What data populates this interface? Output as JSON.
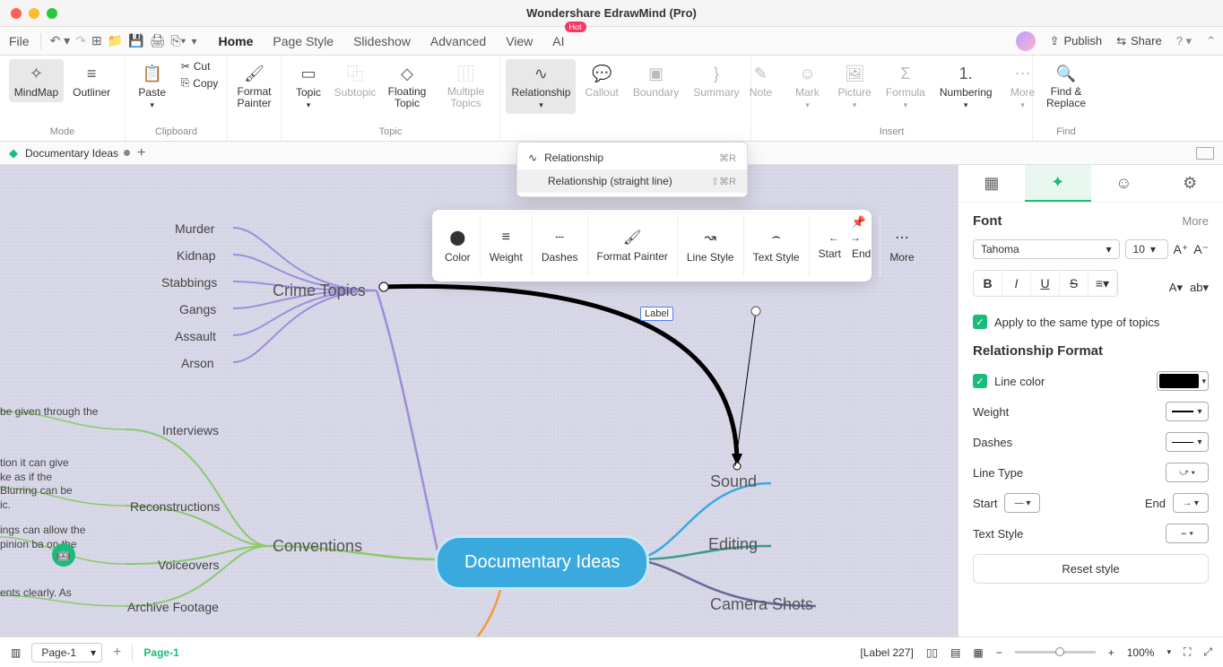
{
  "titlebar": {
    "title": "Wondershare EdrawMind (Pro)"
  },
  "menubar": {
    "file": "File",
    "tabs": [
      "Home",
      "Page Style",
      "Slideshow",
      "Advanced",
      "View",
      "AI"
    ],
    "active": "Home",
    "hot": "Hot",
    "publish": "Publish",
    "share": "Share"
  },
  "ribbon": {
    "mindmap": "MindMap",
    "outliner": "Outliner",
    "mode": "Mode",
    "paste": "Paste",
    "cut": "Cut",
    "copy": "Copy",
    "clipboard": "Clipboard",
    "format_painter": "Format Painter",
    "topic": "Topic",
    "subtopic": "Subtopic",
    "floating_topic": "Floating Topic",
    "multiple_topics": "Multiple Topics",
    "topic_group": "Topic",
    "relationship": "Relationship",
    "callout": "Callout",
    "boundary": "Boundary",
    "summary": "Summary",
    "note": "Note",
    "mark": "Mark",
    "picture": "Picture",
    "formula": "Formula",
    "numbering": "Numbering",
    "more": "More",
    "insert": "Insert",
    "find_replace": "Find & Replace",
    "find": "Find"
  },
  "rel_menu": {
    "item1": "Relationship",
    "item1_sc": "⌘R",
    "item2": "Relationship (straight line)",
    "item2_sc": "⇧⌘R"
  },
  "doc_tab": {
    "name": "Documentary Ideas"
  },
  "context": {
    "color": "Color",
    "weight": "Weight",
    "dashes": "Dashes",
    "format_painter": "Format Painter",
    "line_style": "Line Style",
    "text_style": "Text Style",
    "start": "Start",
    "end": "End",
    "more": "More"
  },
  "mindmap": {
    "central": "Documentary Ideas",
    "crime": "Crime Topics",
    "crime_children": [
      "Murder",
      "Kidnap",
      "Stabbings",
      "Gangs",
      "Assault",
      "Arson"
    ],
    "conventions": "Conventions",
    "conv_children": [
      "Interviews",
      "Reconstructions",
      "Voiceovers",
      "Archive Footage"
    ],
    "right_children": [
      "Sound",
      "Editing",
      "Camera Shots"
    ],
    "left_fragments_a": "be given through the",
    "left_fragments_b1": "tion it can give",
    "left_fragments_b2": "ke as if the",
    "left_fragments_b3": "Blurring can be",
    "left_fragments_b4": "ic.",
    "left_fragments_c1": "ings can allow the",
    "left_fragments_c2": "pinion ba    on the",
    "left_fragments_d": "ents clearly. As",
    "label": "Label"
  },
  "panel": {
    "font": "Font",
    "more": "More",
    "font_family": "Tahoma",
    "font_size": "10",
    "apply_same": "Apply to the same type of topics",
    "rel_format": "Relationship Format",
    "line_color": "Line color",
    "weight": "Weight",
    "dashes": "Dashes",
    "line_type": "Line Type",
    "start": "Start",
    "end": "End",
    "text_style": "Text Style",
    "reset": "Reset style"
  },
  "status": {
    "page_sel": "Page-1",
    "page_tab": "Page-1",
    "label_info": "[Label 227]",
    "zoom": "100%"
  }
}
